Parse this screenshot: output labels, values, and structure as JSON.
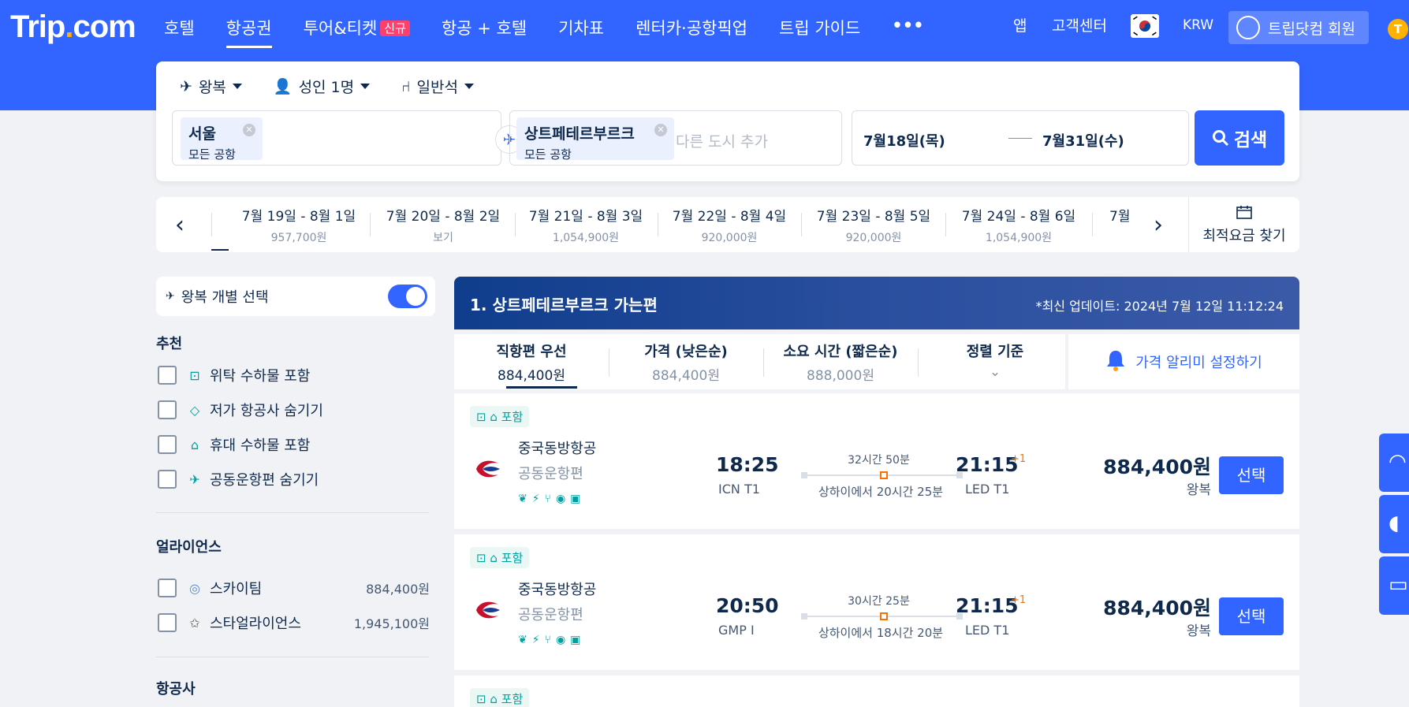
{
  "brand": {
    "logo_pre": "Trip",
    "logo_dot": ".",
    "logo_post": "com"
  },
  "nav": {
    "items": [
      {
        "label": "호텔"
      },
      {
        "label": "항공권"
      },
      {
        "label": "투어&티켓"
      },
      {
        "label": "항공 + 호텔"
      },
      {
        "label": "기차표"
      },
      {
        "label": "렌터카·공항픽업"
      },
      {
        "label": "트립 가이드"
      },
      {
        "label": "•••"
      }
    ],
    "new_badge": "신규",
    "app": "앱",
    "support": "고객센터",
    "currency": "KRW",
    "member": "트립닷컴 회원",
    "coin": "T"
  },
  "search": {
    "trip_type": "왕복",
    "passengers": "성인 1명",
    "cabin": "일반석",
    "origin": {
      "city": "서울",
      "sub": "모든 공항"
    },
    "destination": {
      "city": "상트페테르부르크",
      "sub": "모든 공항"
    },
    "add_city": "다른 도시 추가",
    "depart_date": "7월18일(목)",
    "return_date": "7월31일(수)",
    "button": "검색"
  },
  "datebar": {
    "dates": [
      {
        "range": "7월 19일 - 8월 1일",
        "price": "957,700원"
      },
      {
        "range": "7월 20일 - 8월 2일",
        "price": "보기"
      },
      {
        "range": "7월 21일 - 8월 3일",
        "price": "1,054,900원"
      },
      {
        "range": "7월 22일 - 8월 4일",
        "price": "920,000원"
      },
      {
        "range": "7월 23일 - 8월 5일",
        "price": "920,000원"
      },
      {
        "range": "7월 24일 - 8월 6일",
        "price": "1,054,900원"
      }
    ],
    "partial": "7월",
    "cheapest": "최적요금 찾기"
  },
  "filters": {
    "separate_toggle": "왕복 개별 선택",
    "recommend_title": "추천",
    "recommend": [
      {
        "label": "위탁 수하물 포함",
        "icon": "luggage-icon"
      },
      {
        "label": "저가 항공사 숨기기",
        "icon": "tag-icon"
      },
      {
        "label": "휴대 수하물 포함",
        "icon": "carry-on-icon"
      },
      {
        "label": "공동운항편 숨기기",
        "icon": "plane-icon"
      }
    ],
    "alliance_title": "얼라이언스",
    "alliances": [
      {
        "label": "스카이팀",
        "price": "884,400원"
      },
      {
        "label": "스타얼라이언스",
        "price": "1,945,100원"
      }
    ],
    "airline_title": "항공사"
  },
  "results": {
    "title": "1. 상트페테르부르크 가는편",
    "updated": "*최신 업데이트: 2024년 7월 12일 11:12:24",
    "sort": [
      {
        "label": "직항편 우선",
        "price": "884,400원"
      },
      {
        "label": "가격 (낮은순)",
        "price": "884,400원"
      },
      {
        "label": "소요 시간 (짧은순)",
        "price": "888,000원"
      },
      {
        "label": "정렬 기준",
        "price": "⌄"
      }
    ],
    "alert": "가격 알리미 설정하기",
    "flights": [
      {
        "tag": "포함",
        "airline": "중국동방항공",
        "codeshare": "공동운항편",
        "dep_time": "18:25",
        "dep_airport": "ICN T1",
        "duration": "32시간 50분",
        "stop": "상하이에서 20시간 25분",
        "arr_time": "21:15",
        "plus": "+1",
        "arr_airport": "LED T1",
        "price": "884,400원",
        "price_type": "왕복",
        "select": "선택"
      },
      {
        "tag": "포함",
        "airline": "중국동방항공",
        "codeshare": "공동운항편",
        "dep_time": "20:50",
        "dep_airport": "GMP I",
        "duration": "30시간 25분",
        "stop": "상하이에서 18시간 20분",
        "arr_time": "21:15",
        "plus": "+1",
        "arr_airport": "LED T1",
        "price": "884,400원",
        "price_type": "왕복",
        "select": "선택"
      },
      {
        "tag": "포함"
      }
    ]
  },
  "colors": {
    "brand": "#3264ff",
    "accent": "#ff6f00",
    "teal": "#00a0a0"
  }
}
